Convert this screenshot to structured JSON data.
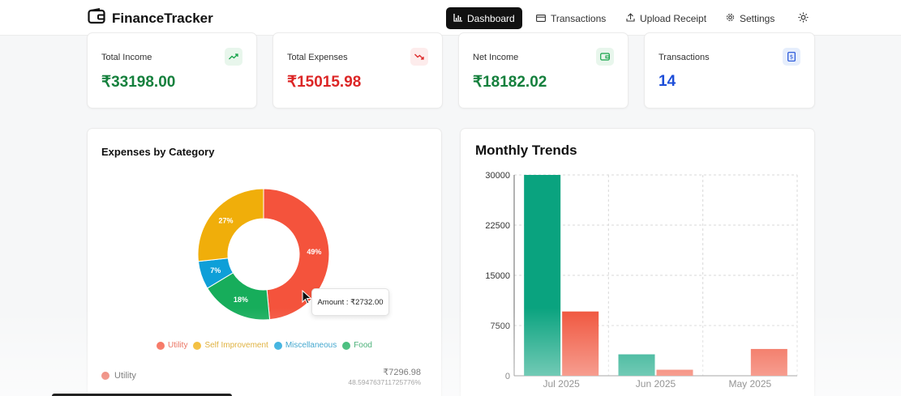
{
  "app": {
    "name": "FinanceTracker"
  },
  "nav": {
    "items": [
      {
        "label": "Dashboard",
        "icon": "bar-chart-icon",
        "active": true
      },
      {
        "label": "Transactions",
        "icon": "card-icon",
        "active": false
      },
      {
        "label": "Upload Receipt",
        "icon": "upload-icon",
        "active": false
      },
      {
        "label": "Settings",
        "icon": "gear-icon",
        "active": false
      }
    ],
    "theme_toggle_icon": "sun-icon"
  },
  "stats": [
    {
      "label": "Total Income",
      "value": "₹33198.00",
      "color": "#15803d",
      "icon": "trending-up-icon",
      "icon_bg": "#e8f6ec",
      "icon_color": "#16a34a"
    },
    {
      "label": "Total Expenses",
      "value": "₹15015.98",
      "color": "#dc2626",
      "icon": "trending-down-icon",
      "icon_bg": "#fdecec",
      "icon_color": "#dc2626"
    },
    {
      "label": "Net Income",
      "value": "₹18182.02",
      "color": "#15803d",
      "icon": "wallet-icon",
      "icon_bg": "#e8f6ec",
      "icon_color": "#16a34a"
    },
    {
      "label": "Transactions",
      "value": "14",
      "color": "#1d4ed8",
      "icon": "receipt-icon",
      "icon_bg": "#e6eefc",
      "icon_color": "#1d4ed8"
    }
  ],
  "expenses_panel": {
    "title": "Expenses by Category",
    "tooltip": "Amount : ₹2732.00",
    "row": {
      "label": "Utility",
      "amount": "₹7296.98",
      "percent": "48.594763711725776%"
    }
  },
  "trends_panel": {
    "title": "Monthly Trends"
  },
  "chart_data": [
    {
      "type": "pie",
      "title": "Expenses by Category",
      "categories": [
        "Utility",
        "Self Improvement",
        "Miscellaneous",
        "Food"
      ],
      "values": [
        49,
        27,
        7,
        18
      ],
      "value_labels": [
        "49%",
        "27%",
        "7%",
        "18%"
      ],
      "colors": [
        "#f4533c",
        "#f0ae0a",
        "#0e9fd8",
        "#17ad5b"
      ],
      "legend": "bottom"
    },
    {
      "type": "bar",
      "title": "Monthly Trends",
      "categories": [
        "Jul 2025",
        "Jun 2025",
        "May 2025"
      ],
      "series": [
        {
          "values": [
            30000,
            3200,
            0
          ],
          "color": "#0aa37f"
        },
        {
          "values": [
            9600,
            900,
            4000
          ],
          "color": "#f0553d"
        }
      ],
      "yticks": [
        "0",
        "7500",
        "15000",
        "22500",
        "30000"
      ],
      "ylim": [
        0,
        30000
      ],
      "grid": true
    }
  ]
}
